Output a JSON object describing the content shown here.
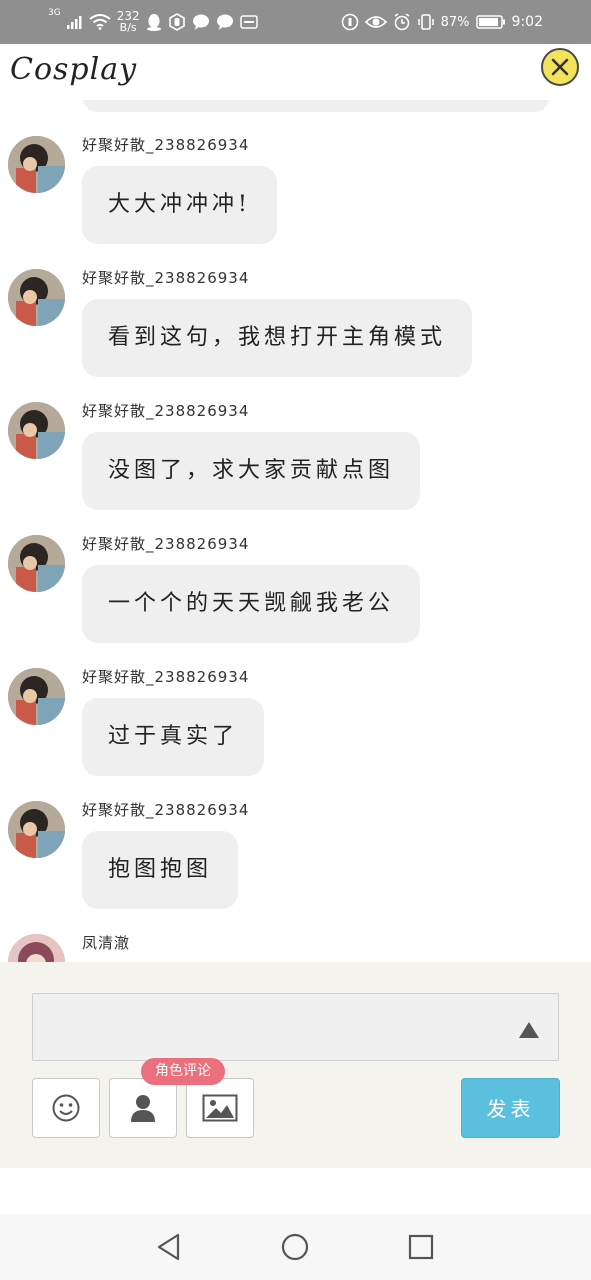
{
  "status_bar": {
    "network": "3G",
    "speed_value": "232",
    "speed_unit": "B/s",
    "battery": "87%",
    "time": "9:02"
  },
  "header": {
    "title": "Cosplay",
    "close_icon": "close-icon"
  },
  "messages": [
    {
      "username": "好聚好散_238826934",
      "text": "大大冲冲冲!"
    },
    {
      "username": "好聚好散_238826934",
      "text": "看到这句，我想打开主角模式"
    },
    {
      "username": "好聚好散_238826934",
      "text": "没图了，求大家贡献点图"
    },
    {
      "username": "好聚好散_238826934",
      "text": "一个个的天天觊觎我老公"
    },
    {
      "username": "好聚好散_238826934",
      "text": "过于真实了"
    },
    {
      "username": "好聚好散_238826934",
      "text": "抱图抱图"
    },
    {
      "username": "凤清澈",
      "text": ""
    }
  ],
  "composer": {
    "input_value": "",
    "role_comment_badge": "角色评论",
    "send_label": "发表",
    "tools": [
      "emoji-icon",
      "person-icon",
      "image-icon"
    ]
  },
  "nav": {
    "back_icon": "back-triangle-icon",
    "home_icon": "home-circle-icon",
    "recent_icon": "recent-square-icon"
  },
  "colors": {
    "status_bar": "#8f8f8f",
    "bubble": "#efefef",
    "composer_bg": "#f5f3ee",
    "send_button": "#5bc0de",
    "badge": "#eb6f7c",
    "close_button": "#f3e35a"
  }
}
